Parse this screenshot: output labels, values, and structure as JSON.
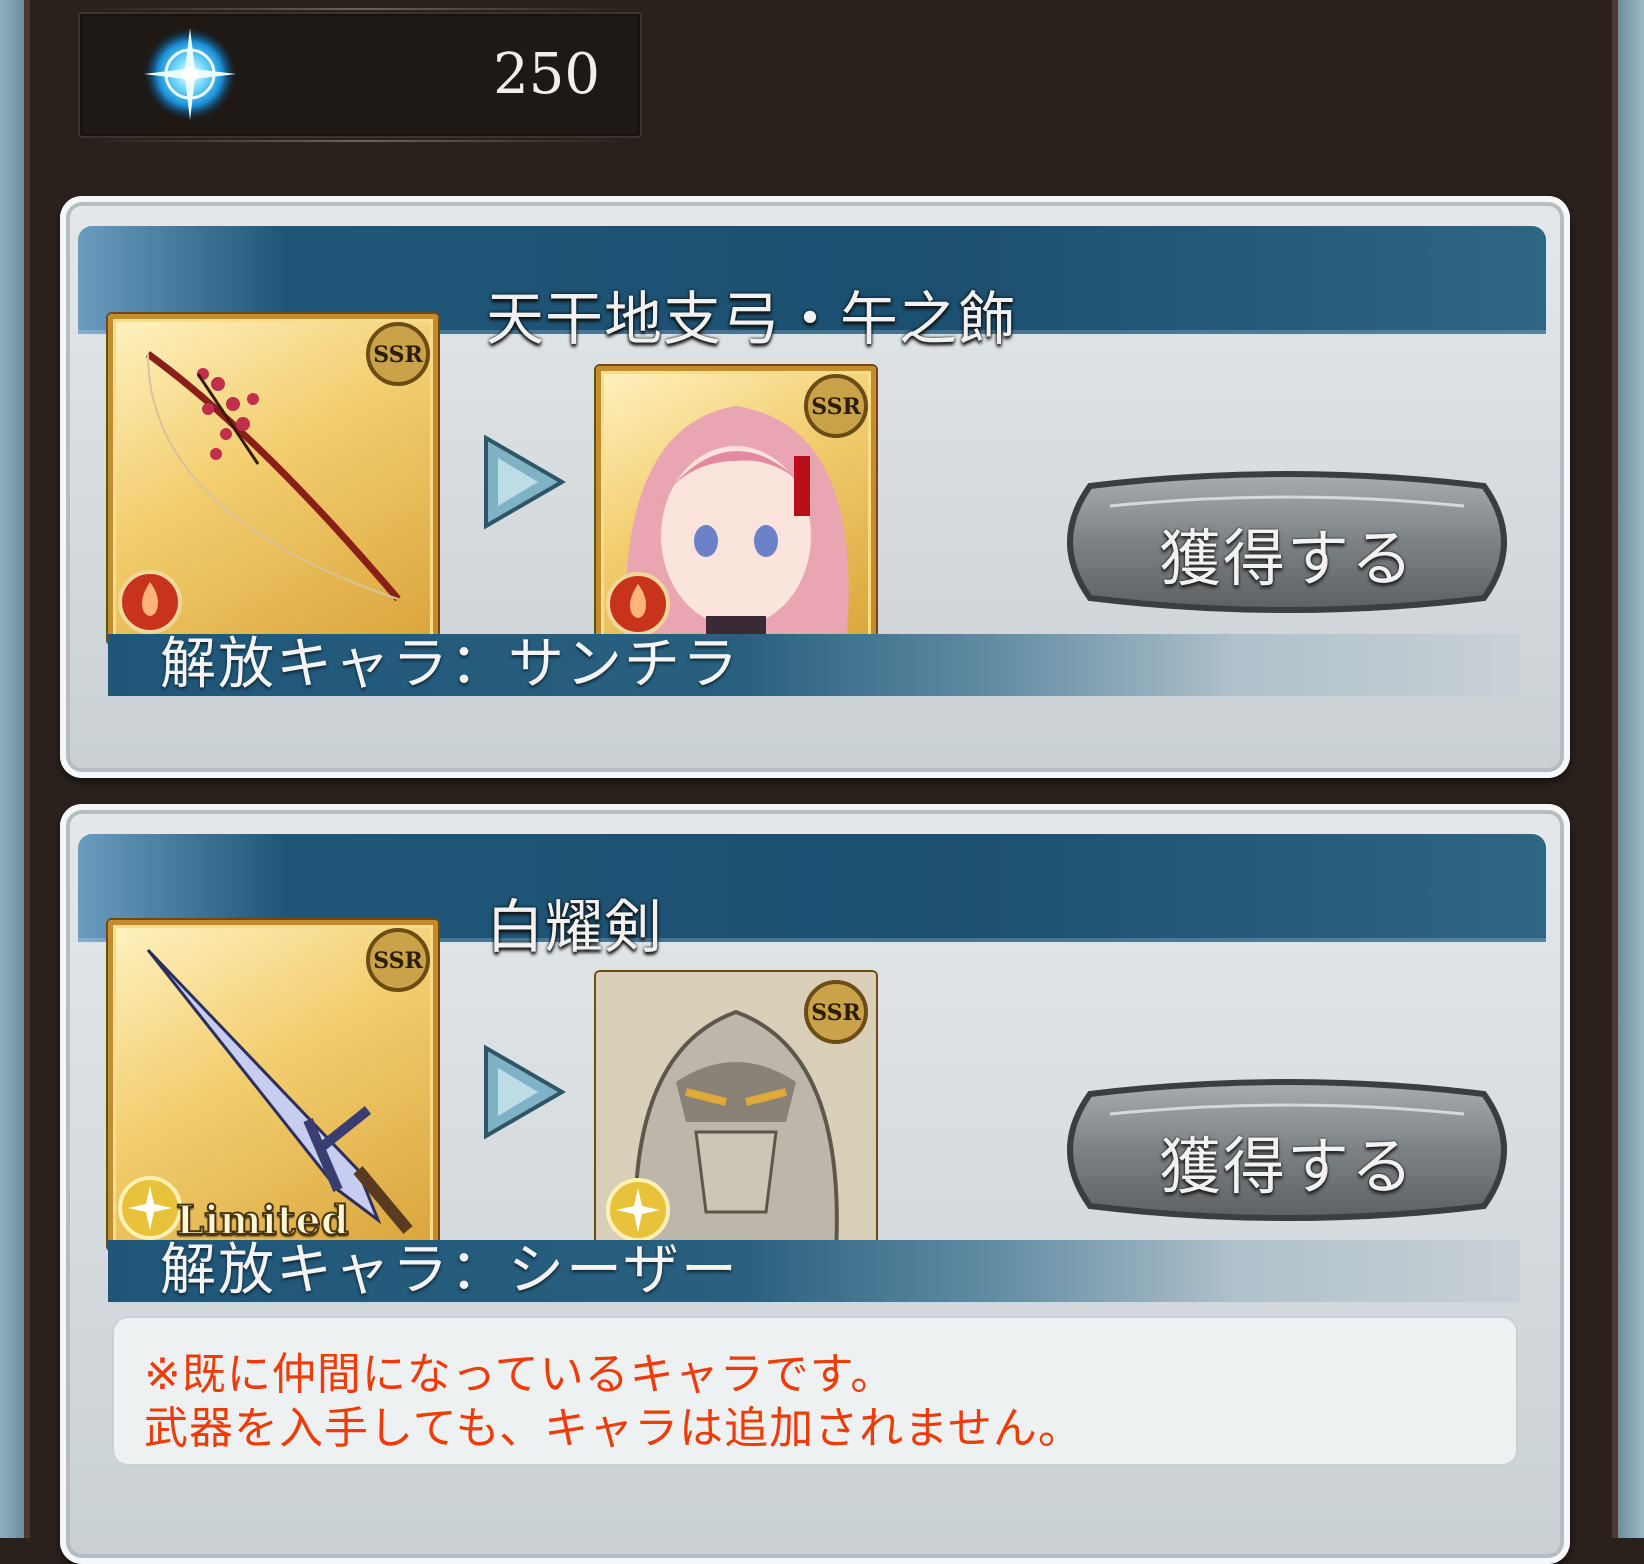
{
  "currency": {
    "icon": "crystal-icon",
    "value": "250"
  },
  "colors": {
    "frame": "#2a211c",
    "title_bar": "#1c4f70",
    "notice_text": "#ef3b08",
    "card": "#dde2e5"
  },
  "items": [
    {
      "weapon_name": "天干地支弓・午之飾",
      "weapon_icon": "bow-icon",
      "weapon_rarity": "SSR",
      "weapon_element": "fire-element-icon",
      "character_rarity": "SSR",
      "character_element": "fire-element-icon",
      "acquire_label": "獲得する",
      "release_label": "解放キャラ：サンチラ"
    },
    {
      "weapon_name": "白耀剣",
      "weapon_icon": "sword-icon",
      "weapon_rarity": "SSR",
      "weapon_badge": "Limited",
      "weapon_element": "light-element-icon",
      "character_rarity": "SSR",
      "character_element": "light-element-icon",
      "acquire_label": "獲得する",
      "release_label": "解放キャラ：シーザー",
      "notice": [
        "※既に仲間になっているキャラです。",
        "武器を入手しても、キャラは追加されません。"
      ]
    }
  ]
}
